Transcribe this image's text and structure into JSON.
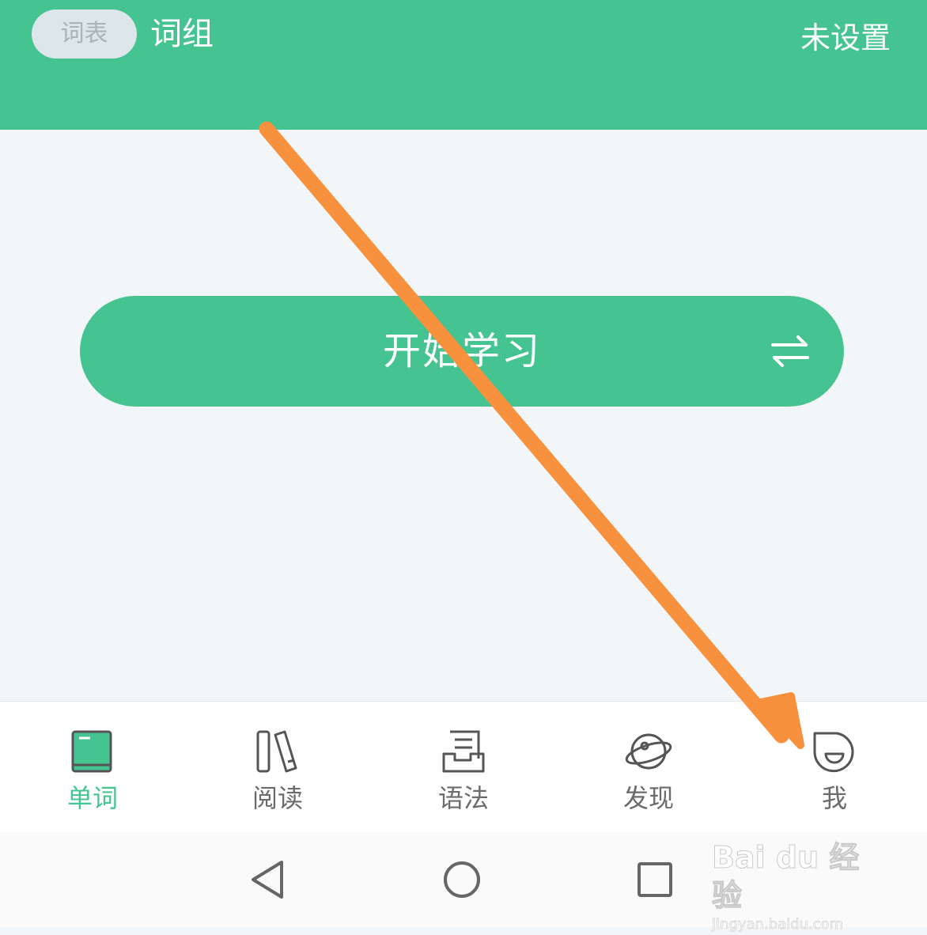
{
  "header": {
    "tab_wordlist": "词表",
    "tab_phrases": "词组",
    "right_status": "未设置"
  },
  "main": {
    "start_button_label": "开始学习",
    "swap_icon": "swap-arrows-icon"
  },
  "tabbar": {
    "items": [
      {
        "label": "单词",
        "icon": "book-icon",
        "active": true
      },
      {
        "label": "阅读",
        "icon": "books-icon",
        "active": false
      },
      {
        "label": "语法",
        "icon": "grammar-doc-icon",
        "active": false
      },
      {
        "label": "发现",
        "icon": "planet-icon",
        "active": false
      },
      {
        "label": "我",
        "icon": "smile-face-icon",
        "active": false
      }
    ]
  },
  "system_nav": {
    "keys": [
      "back-triangle-icon",
      "home-circle-icon",
      "recents-square-icon"
    ]
  },
  "watermark": {
    "logo": "Bai du 经验",
    "url": "jingyan.baidu.com"
  },
  "colors": {
    "brand_green": "#45c491",
    "annotation_arrow": "#f7913d",
    "background": "#f3f6f8",
    "inactive_label": "#6b6b6b"
  }
}
